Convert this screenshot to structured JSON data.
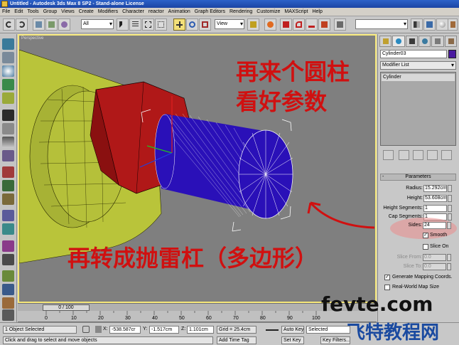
{
  "window": {
    "title": "Untitled - Autodesk 3ds Max 8 SP2 - Stand-alone License"
  },
  "menu": [
    "File",
    "Edit",
    "Tools",
    "Group",
    "Views",
    "Create",
    "Modifiers",
    "Character",
    "reactor",
    "Animation",
    "Graph Editors",
    "Rendering",
    "Customize",
    "MAXScript",
    "Help"
  ],
  "toolbar": {
    "selection_filter": "All",
    "coordinate_system": "View"
  },
  "viewport": {
    "label": "Perspective",
    "annotation_top_line1": "再来个圆柱",
    "annotation_top_line2": "看好参数",
    "annotation_bottom": "再转成抛雷杠（多边形）"
  },
  "command_panel": {
    "object_name": "Cylinder03",
    "object_color": "#4a1aa0",
    "modifier_list_label": "Modifier List",
    "stack_item": "Cylinder",
    "rollout_title": "Parameters",
    "params": [
      {
        "label": "Radius:",
        "value": "15.292cm",
        "enabled": true
      },
      {
        "label": "Height:",
        "value": "53.608cm",
        "enabled": true
      },
      {
        "label": "Height Segments:",
        "value": "1",
        "enabled": true
      },
      {
        "label": "Cap Segments:",
        "value": "1",
        "enabled": true
      },
      {
        "label": "Sides:",
        "value": "24",
        "enabled": true
      }
    ],
    "smooth_label": "Smooth",
    "slice_on_label": "Slice On",
    "slice_from_label": "Slice From:",
    "slice_from_value": "0.0",
    "slice_to_label": "Slice To:",
    "slice_to_value": "0.0",
    "gen_mapping_label": "Generate Mapping Coords.",
    "real_world_label": "Real-World Map Size"
  },
  "timeline": {
    "slider_label": "0 / 100",
    "ticks": [
      "0",
      "10",
      "20",
      "30",
      "40",
      "50",
      "60",
      "70",
      "80",
      "90",
      "100"
    ]
  },
  "status_bar": {
    "selection_status": "1 Object Selected",
    "prompt": "Click and drag to select and move objects",
    "x_label": "X:",
    "x_value": "-538.587cr",
    "y_label": "Y:",
    "y_value": "-1.517cm",
    "z_label": "Z:",
    "z_value": "1.101cm",
    "grid": "Grid = 25.4cm",
    "add_time_tag": "Add Time Tag",
    "auto_key": "Auto Key",
    "set_key": "Set Key",
    "selected_dropdown": "Selected",
    "key_filters": "Key Filters..."
  },
  "watermark": {
    "line1": "fevte.com",
    "line2": "飞特教程网"
  }
}
